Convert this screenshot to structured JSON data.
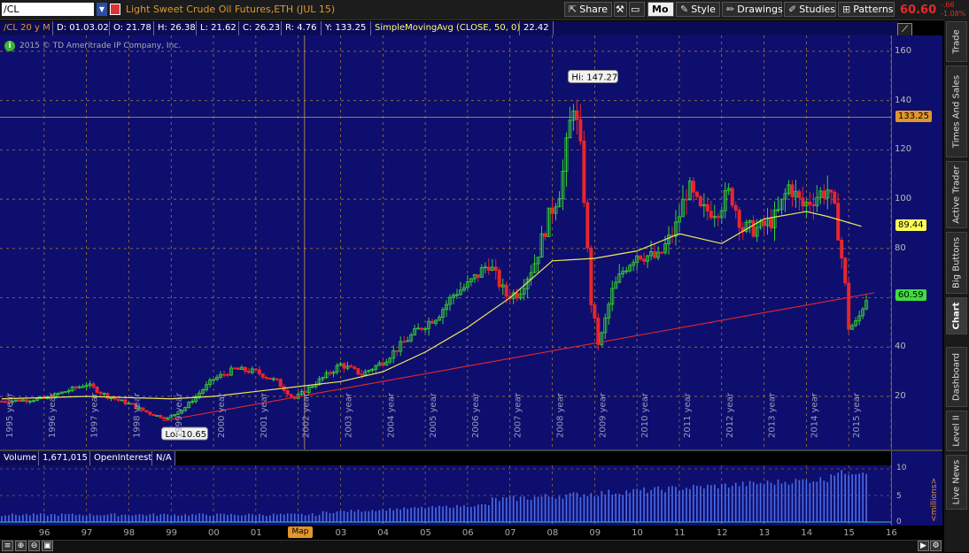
{
  "toolbar": {
    "symbol": "/CL",
    "description": "Light Sweet Crude Oil Futures,ETH (JUL 15)",
    "share_label": "Share",
    "mo_label": "Mo",
    "style_label": "Style",
    "drawings_label": "Drawings",
    "studies_label": "Studies",
    "patterns_label": "Patterns",
    "last_price": "60.60",
    "change_abs": "-.66",
    "change_pct": "-1.08%"
  },
  "infobar": {
    "symbol_period": "/CL 20 y M",
    "date": "D: 01.03.02",
    "open": "O: 21.78",
    "high": "H: 26.38",
    "low": "L: 21.62",
    "close": "C: 26.23",
    "range": "R: 4.76",
    "y": "Y: 133.25",
    "study": "SimpleMovingAvg (CLOSE, 50, 0)",
    "study_value": "22.42"
  },
  "chart": {
    "copyright": "2015 © TD Ameritrade IP Company, Inc.",
    "hi_label": "Hi: 147.27",
    "lo_label": "Lo: 10.65",
    "y_ticks": [
      "160",
      "140",
      "120",
      "100",
      "80",
      "60",
      "40",
      "20"
    ],
    "crosshair_price": "133.25",
    "sma_price": "89.44",
    "last_price": "60.59",
    "year_labels": [
      "1995 year",
      "1996 year",
      "1997 year",
      "1998 year",
      "1999 year",
      "2000 year",
      "2001 year",
      "2002 year",
      "2003 year",
      "2004 year",
      "2005 year",
      "2006 year",
      "2007 year",
      "2008 year",
      "2009 year",
      "2010 year",
      "2011 year",
      "2012 year",
      "2013 year",
      "2014 year",
      "2015 year"
    ]
  },
  "volume": {
    "label": "Volume",
    "value": "1,671,015",
    "oi_label": "OpenInterest",
    "oi_value": "N/A",
    "y_ticks": [
      "10",
      "5",
      "0"
    ],
    "units": "<millions>"
  },
  "xaxis": {
    "labels": [
      "96",
      "97",
      "98",
      "99",
      "00",
      "01",
      "02",
      "03",
      "04",
      "05",
      "06",
      "07",
      "08",
      "09",
      "10",
      "11",
      "12",
      "13",
      "14",
      "15",
      "16"
    ],
    "map_label": "Map"
  },
  "side_tabs": [
    "Trade",
    "Times And Sales",
    "Active Trader",
    "Big Buttons",
    "Chart",
    "Dashboard",
    "Level II",
    "Live News"
  ],
  "chart_data": {
    "type": "candlestick",
    "title": "Light Sweet Crude Oil Futures,ETH (JUL 15)",
    "ylim": [
      0,
      165
    ],
    "x_range": [
      1995,
      2016
    ],
    "y_ticks": [
      20,
      40,
      60,
      80,
      100,
      120,
      140,
      160
    ],
    "series": [
      {
        "name": "price",
        "points": [
          [
            1995.0,
            18
          ],
          [
            1995.5,
            18.5
          ],
          [
            1996.0,
            19
          ],
          [
            1996.5,
            22
          ],
          [
            1997.0,
            25
          ],
          [
            1997.5,
            20
          ],
          [
            1998.0,
            17
          ],
          [
            1998.5,
            13
          ],
          [
            1998.9,
            11
          ],
          [
            1999.3,
            15
          ],
          [
            1999.7,
            22
          ],
          [
            2000.0,
            27
          ],
          [
            2000.5,
            31
          ],
          [
            2001.0,
            30
          ],
          [
            2001.5,
            26
          ],
          [
            2001.9,
            19
          ],
          [
            2002.3,
            24
          ],
          [
            2002.7,
            29
          ],
          [
            2003.0,
            33
          ],
          [
            2003.5,
            29
          ],
          [
            2004.0,
            34
          ],
          [
            2004.5,
            42
          ],
          [
            2004.9,
            48
          ],
          [
            2005.3,
            53
          ],
          [
            2005.7,
            62
          ],
          [
            2006.0,
            65
          ],
          [
            2006.5,
            74
          ],
          [
            2006.9,
            61
          ],
          [
            2007.2,
            62
          ],
          [
            2007.6,
            75
          ],
          [
            2007.9,
            92
          ],
          [
            2008.2,
            105
          ],
          [
            2008.5,
            140
          ],
          [
            2008.7,
            115
          ],
          [
            2008.9,
            60
          ],
          [
            2009.1,
            40
          ],
          [
            2009.4,
            62
          ],
          [
            2009.7,
            72
          ],
          [
            2010.0,
            78
          ],
          [
            2010.5,
            76
          ],
          [
            2010.9,
            88
          ],
          [
            2011.2,
            105
          ],
          [
            2011.5,
            95
          ],
          [
            2011.9,
            96
          ],
          [
            2012.2,
            103
          ],
          [
            2012.5,
            88
          ],
          [
            2012.9,
            88
          ],
          [
            2013.3,
            93
          ],
          [
            2013.6,
            106
          ],
          [
            2013.9,
            97
          ],
          [
            2014.2,
            101
          ],
          [
            2014.5,
            104
          ],
          [
            2014.7,
            93
          ],
          [
            2014.9,
            68
          ],
          [
            2015.0,
            48
          ],
          [
            2015.2,
            50
          ],
          [
            2015.4,
            60
          ]
        ]
      },
      {
        "name": "SimpleMovingAvg (CLOSE, 50, 0)",
        "points": [
          [
            1995,
            19
          ],
          [
            1996,
            19.5
          ],
          [
            1997,
            20
          ],
          [
            1998,
            19.5
          ],
          [
            1999,
            19
          ],
          [
            2000,
            20
          ],
          [
            2001,
            22
          ],
          [
            2002,
            24
          ],
          [
            2003,
            26
          ],
          [
            2004,
            30
          ],
          [
            2005,
            38
          ],
          [
            2006,
            48
          ],
          [
            2007,
            60
          ],
          [
            2008,
            75
          ],
          [
            2009,
            76
          ],
          [
            2010,
            79
          ],
          [
            2011,
            86
          ],
          [
            2012,
            82
          ],
          [
            2013,
            92
          ],
          [
            2014,
            95
          ],
          [
            2014.5,
            93
          ],
          [
            2015.3,
            89
          ]
        ]
      },
      {
        "name": "trendline",
        "points": [
          [
            1998.8,
            10
          ],
          [
            2015.6,
            62
          ]
        ]
      }
    ],
    "hi": 147.27,
    "lo": 10.65,
    "volume_ylim": [
      0,
      10
    ]
  }
}
